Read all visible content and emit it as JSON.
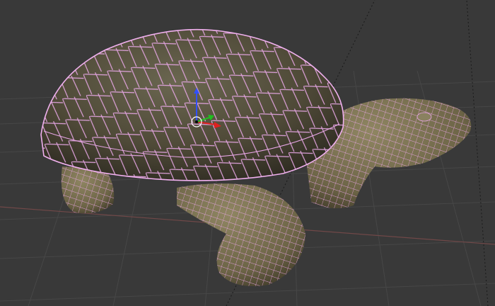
{
  "viewport": {
    "background": "#393939",
    "grid_color": "#4a4a4a",
    "x_axis_color": "#7a4a4a",
    "wireframe_color": "#e8a6e6"
  },
  "model": {
    "shell_color": "#5f5a45",
    "skin_color": "#7a7152"
  },
  "gizmo": {
    "icon": "transform-manipulator-icon",
    "axis_colors": {
      "x": "#e02020",
      "y": "#20c020",
      "z": "#3050ff"
    }
  }
}
